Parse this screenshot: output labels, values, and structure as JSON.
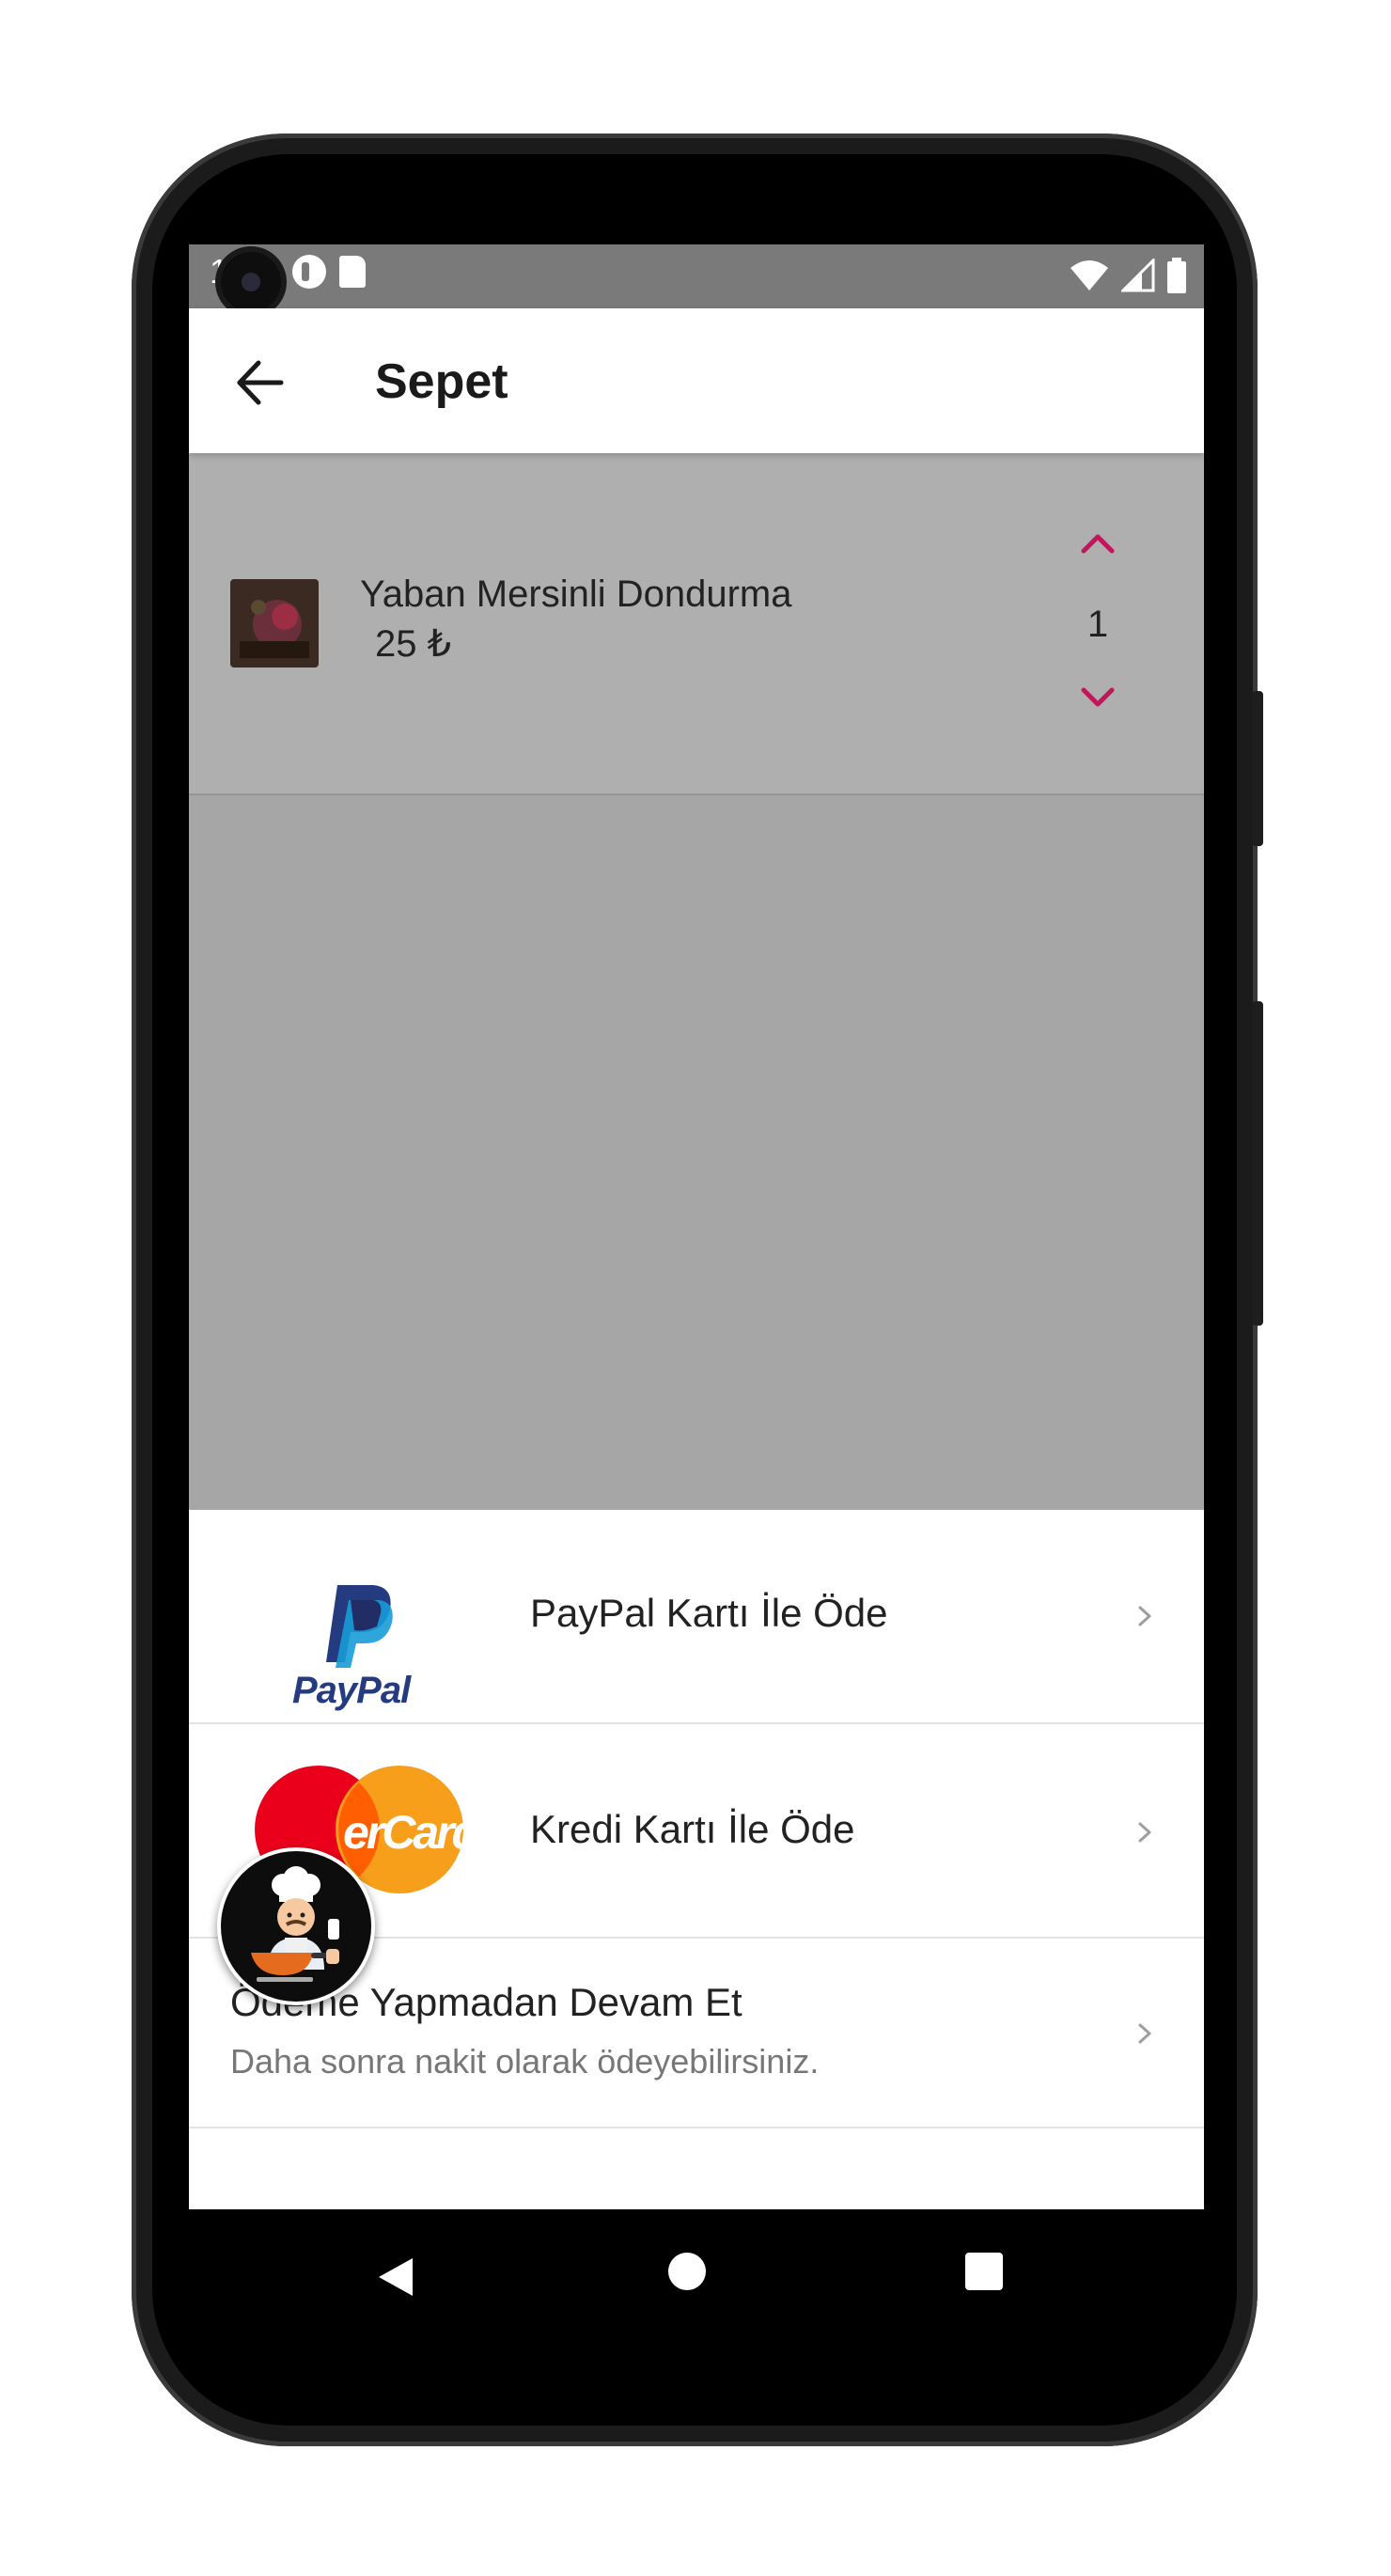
{
  "status_bar": {
    "time": "1:57"
  },
  "app_bar": {
    "title": "Sepet"
  },
  "cart": {
    "items": [
      {
        "name": "Yaban Mersinli Dondurma",
        "price": "25 ₺",
        "quantity": "1"
      }
    ]
  },
  "payment_options": {
    "paypal": {
      "label": "PayPal Kartı İle Öde",
      "logo_text": "PayPal"
    },
    "credit_card": {
      "label": "Kredi Kartı İle Öde",
      "logo_text": "erCard"
    },
    "no_payment": {
      "title": "Ödeme Yapmadan Devam Et",
      "subtitle": "Daha sonra nakit olarak ödeyebilirsiniz."
    }
  },
  "colors": {
    "accent": "#c2185b",
    "status_bar": "#7a7a7a",
    "scrim": "#a6a6a6",
    "paypal_dark": "#253b80",
    "paypal_light": "#179bd7",
    "mastercard_red": "#eb001b",
    "mastercard_orange": "#f79e1b"
  },
  "icons": {
    "back": "arrow-left-icon",
    "qty_up": "chevron-up-icon",
    "qty_down": "chevron-down-icon",
    "row_chevron": "chevron-right-icon",
    "fab": "chef-icon"
  }
}
